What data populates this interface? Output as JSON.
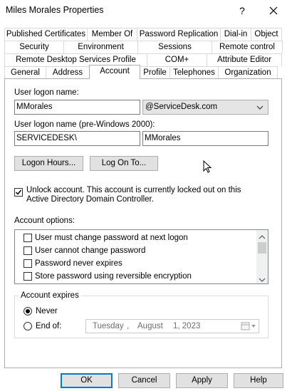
{
  "window": {
    "title": "Miles Morales Properties"
  },
  "tabs": {
    "row1": [
      "Published Certificates",
      "Member Of",
      "Password Replication",
      "Dial-in",
      "Object"
    ],
    "row2": [
      "Security",
      "Environment",
      "Sessions",
      "Remote control"
    ],
    "row3": [
      "Remote Desktop Services Profile",
      "COM+",
      "Attribute Editor"
    ],
    "row4": [
      "General",
      "Address",
      "Account",
      "Profile",
      "Telephones",
      "Organization"
    ],
    "active": "Account"
  },
  "account": {
    "logon_name_label": "User logon name:",
    "logon_name_value": "MMorales",
    "upn_suffix": "@ServiceDesk.com",
    "pre2000_label": "User logon name (pre-Windows 2000):",
    "pre2000_domain": "SERVICEDESK\\",
    "pre2000_user": "MMorales",
    "logon_hours_button": "Logon Hours...",
    "logon_to_button": "Log On To...",
    "unlock_checked": true,
    "unlock_text": "Unlock account. This account is currently locked out on this Active Directory Domain Controller.",
    "options_label": "Account options:",
    "options": [
      {
        "label": "User must change password at next logon",
        "checked": false
      },
      {
        "label": "User cannot change password",
        "checked": false
      },
      {
        "label": "Password never expires",
        "checked": false
      },
      {
        "label": "Store password using reversible encryption",
        "checked": false
      }
    ],
    "expires_legend": "Account expires",
    "never_label": "Never",
    "endof_label": "End of:",
    "expires_selected": "Never",
    "date": {
      "weekday": "Tuesday",
      "month": "August",
      "day_year": "1, 2023"
    }
  },
  "buttons": {
    "ok": "OK",
    "cancel": "Cancel",
    "apply": "Apply",
    "help": "Help"
  }
}
